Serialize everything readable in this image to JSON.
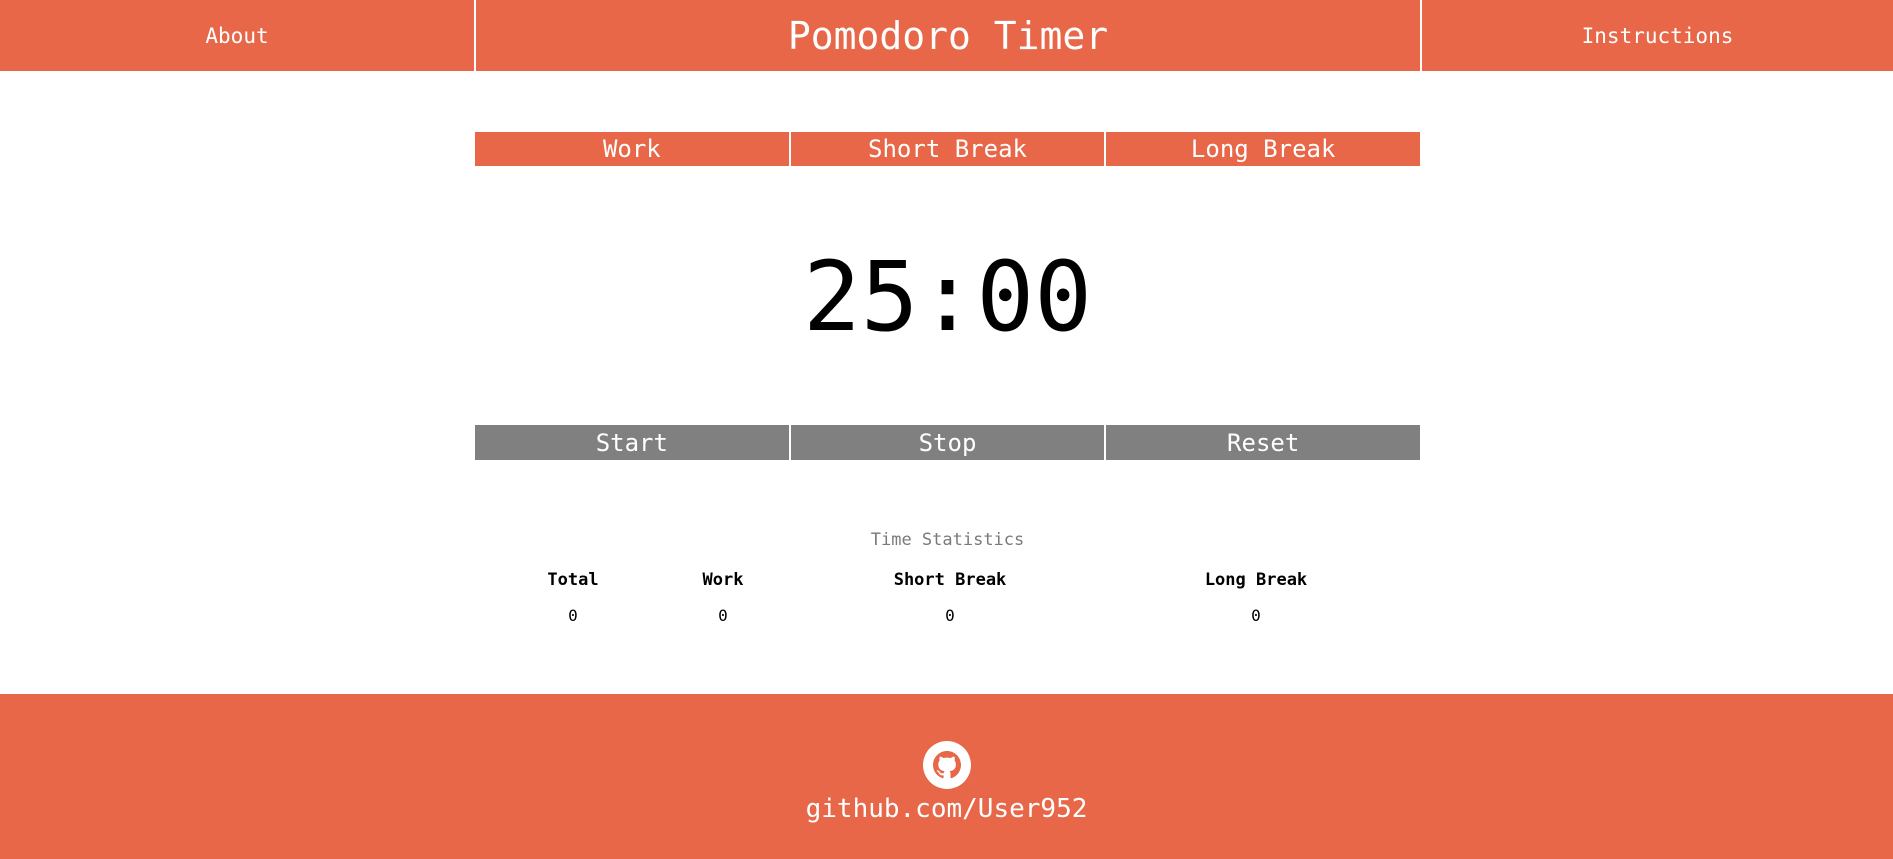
{
  "header": {
    "about_label": "About",
    "title": "Pomodoro Timer",
    "instructions_label": "Instructions"
  },
  "modes": {
    "work": "Work",
    "short_break": "Short Break",
    "long_break": "Long Break"
  },
  "timer": {
    "display": "25:00"
  },
  "controls": {
    "start": "Start",
    "stop": "Stop",
    "reset": "Reset"
  },
  "stats": {
    "title": "Time Statistics",
    "columns": [
      {
        "label": "Total",
        "value": "0"
      },
      {
        "label": "Work",
        "value": "0"
      },
      {
        "label": "Short Break",
        "value": "0"
      },
      {
        "label": "Long Break",
        "value": "0"
      }
    ]
  },
  "footer": {
    "github_icon": "github-icon",
    "link_text": "github.com/User952"
  },
  "colors": {
    "accent": "#e76748",
    "control": "#808080"
  }
}
